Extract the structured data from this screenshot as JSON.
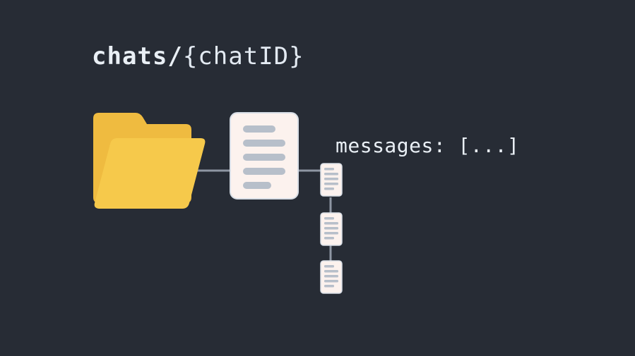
{
  "path": {
    "bold": "chats/",
    "param": "{chatID}"
  },
  "field": "messages: [...]",
  "colors": {
    "bg": "#272C35",
    "text": "#E9EFF5",
    "connector": "#8E96A3",
    "folderBack": "#EFBB40",
    "folderFront": "#F6C94B",
    "paper": "#FCF2EE",
    "paperBorder": "#D8DEE6",
    "line": "#B7BFCA"
  }
}
